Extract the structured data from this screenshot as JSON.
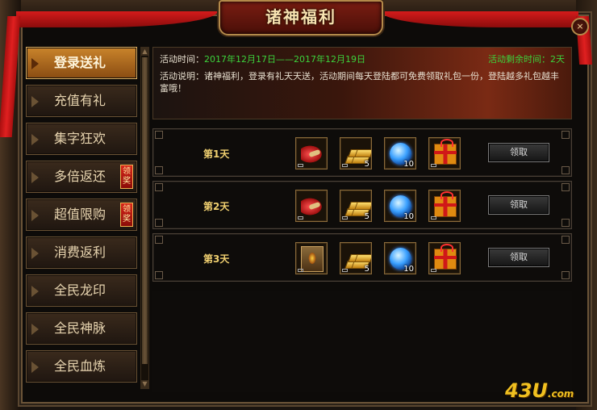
{
  "window": {
    "title": "诸神福利",
    "close_symbol": "×"
  },
  "sidebar": {
    "items": [
      {
        "label": "登录送礼",
        "active": true,
        "badge": ""
      },
      {
        "label": "充值有礼",
        "active": false,
        "badge": ""
      },
      {
        "label": "集字狂欢",
        "active": false,
        "badge": ""
      },
      {
        "label": "多倍返还",
        "active": false,
        "badge": "领奖"
      },
      {
        "label": "超值限购",
        "active": false,
        "badge": "领奖"
      },
      {
        "label": "消费返利",
        "active": false,
        "badge": ""
      },
      {
        "label": "全民龙印",
        "active": false,
        "badge": ""
      },
      {
        "label": "全民神脉",
        "active": false,
        "badge": ""
      },
      {
        "label": "全民血炼",
        "active": false,
        "badge": ""
      }
    ]
  },
  "banner": {
    "time_label": "活动时间：",
    "time_value": "2017年12月17日——2017年12月19日",
    "remaining": "活动剩余时间：2天",
    "description": "活动说明：诸神福利，登录有礼天天送，活动期间每天登陆都可免费领取礼包一份，登陆越多礼包越丰富哦！"
  },
  "rewards": [
    {
      "day": "第1天",
      "items": [
        {
          "icon": "horn-icon",
          "count": ""
        },
        {
          "icon": "gold-icon",
          "count": "5"
        },
        {
          "icon": "orb-icon",
          "count": "10"
        },
        {
          "icon": "gift-icon",
          "count": ""
        }
      ],
      "button": "领取"
    },
    {
      "day": "第2天",
      "items": [
        {
          "icon": "horn-icon",
          "count": ""
        },
        {
          "icon": "gold-icon",
          "count": "5"
        },
        {
          "icon": "orb-icon",
          "count": "10"
        },
        {
          "icon": "gift-icon",
          "count": ""
        }
      ],
      "button": "领取"
    },
    {
      "day": "第3天",
      "items": [
        {
          "icon": "scroll-icon",
          "count": ""
        },
        {
          "icon": "gold-icon",
          "count": "5"
        },
        {
          "icon": "orb-icon",
          "count": "10"
        },
        {
          "icon": "gift-icon",
          "count": ""
        }
      ],
      "button": "领取"
    }
  ],
  "watermark": {
    "main": "43U",
    "suffix": ".com"
  },
  "colors": {
    "accent": "#c9842b",
    "green_text": "#3cd23c",
    "ribbon": "#d41b1b",
    "title_gold": "#f7e2b0"
  }
}
